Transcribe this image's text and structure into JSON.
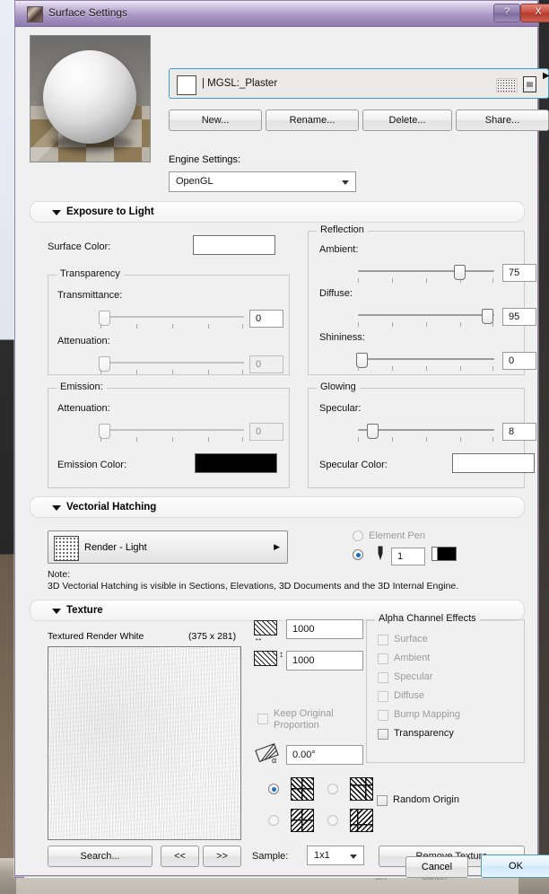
{
  "window": {
    "title": "Surface Settings",
    "icon": "app-icon",
    "help_label": "?",
    "close_label": "X"
  },
  "surface": {
    "name": "| MGSL:_Plaster",
    "swatch_color": "#ffffff",
    "buttons": [
      "New...",
      "Rename...",
      "Delete...",
      "Share..."
    ],
    "engine_label": "Engine Settings:",
    "engine_value": "OpenGL"
  },
  "sections": {
    "exposure": "Exposure to Light",
    "hatching": "Vectorial Hatching",
    "texture": "Texture"
  },
  "exposure": {
    "surface_color_label": "Surface Color:",
    "surface_color": "#ffffff",
    "transparency": {
      "title": "Transparency",
      "transmittance_label": "Transmittance:",
      "transmittance_value": "0",
      "transmittance_pct": 2,
      "attenuation_label": "Attenuation:",
      "attenuation_value": "0",
      "attenuation_pct": 2
    },
    "reflection": {
      "title": "Reflection",
      "ambient_label": "Ambient:",
      "ambient_value": "75",
      "ambient_pct": 74,
      "diffuse_label": "Diffuse:",
      "diffuse_value": "95",
      "diffuse_pct": 94,
      "shininess_label": "Shininess:",
      "shininess_value": "0",
      "shininess_pct": 2
    },
    "emission": {
      "title": "Emission:",
      "attenuation_label": "Attenuation:",
      "attenuation_value": "0",
      "attenuation_pct": 2,
      "color_label": "Emission Color:",
      "color": "#000000"
    },
    "glowing": {
      "title": "Glowing",
      "specular_label": "Specular:",
      "specular_value": "8",
      "specular_pct": 10,
      "color_label": "Specular Color:",
      "color": "#ffffff"
    }
  },
  "hatching": {
    "selector_value": "Render - Light",
    "element_pen_label": "Element Pen",
    "pen_value": "1",
    "pen_color": "#000000",
    "note_title": "Note:",
    "note_text": "3D Vectorial Hatching is visible in Sections, Elevations, 3D Documents and the 3D Internal Engine."
  },
  "texture": {
    "name": "Textured Render White",
    "dimensions": "(375 x 281)",
    "width_value": "1000",
    "height_value": "1000",
    "keep_proportion_label": "Keep Original Proportion",
    "keep_proportion_checked": false,
    "angle_value": "0.00°",
    "orientation_selected": 0,
    "alpha": {
      "title": "Alpha Channel Effects",
      "items": [
        {
          "label": "Surface",
          "enabled": false,
          "checked": false
        },
        {
          "label": "Ambient",
          "enabled": false,
          "checked": false
        },
        {
          "label": "Specular",
          "enabled": false,
          "checked": false
        },
        {
          "label": "Diffuse",
          "enabled": false,
          "checked": false
        },
        {
          "label": "Bump Mapping",
          "enabled": false,
          "checked": false
        },
        {
          "label": "Transparency",
          "enabled": true,
          "checked": false
        }
      ]
    },
    "random_origin_label": "Random Origin",
    "random_origin_checked": false,
    "search_label": "Search...",
    "prev_label": "<<",
    "next_label": ">>",
    "sample_label": "Sample:",
    "sample_value": "1x1",
    "remove_label": "Remove Texture"
  },
  "footer": {
    "cancel": "Cancel",
    "ok": "OK"
  },
  "desktop": {
    "ghost_ok": "OK",
    "ghost_cancel": "Cancel"
  }
}
